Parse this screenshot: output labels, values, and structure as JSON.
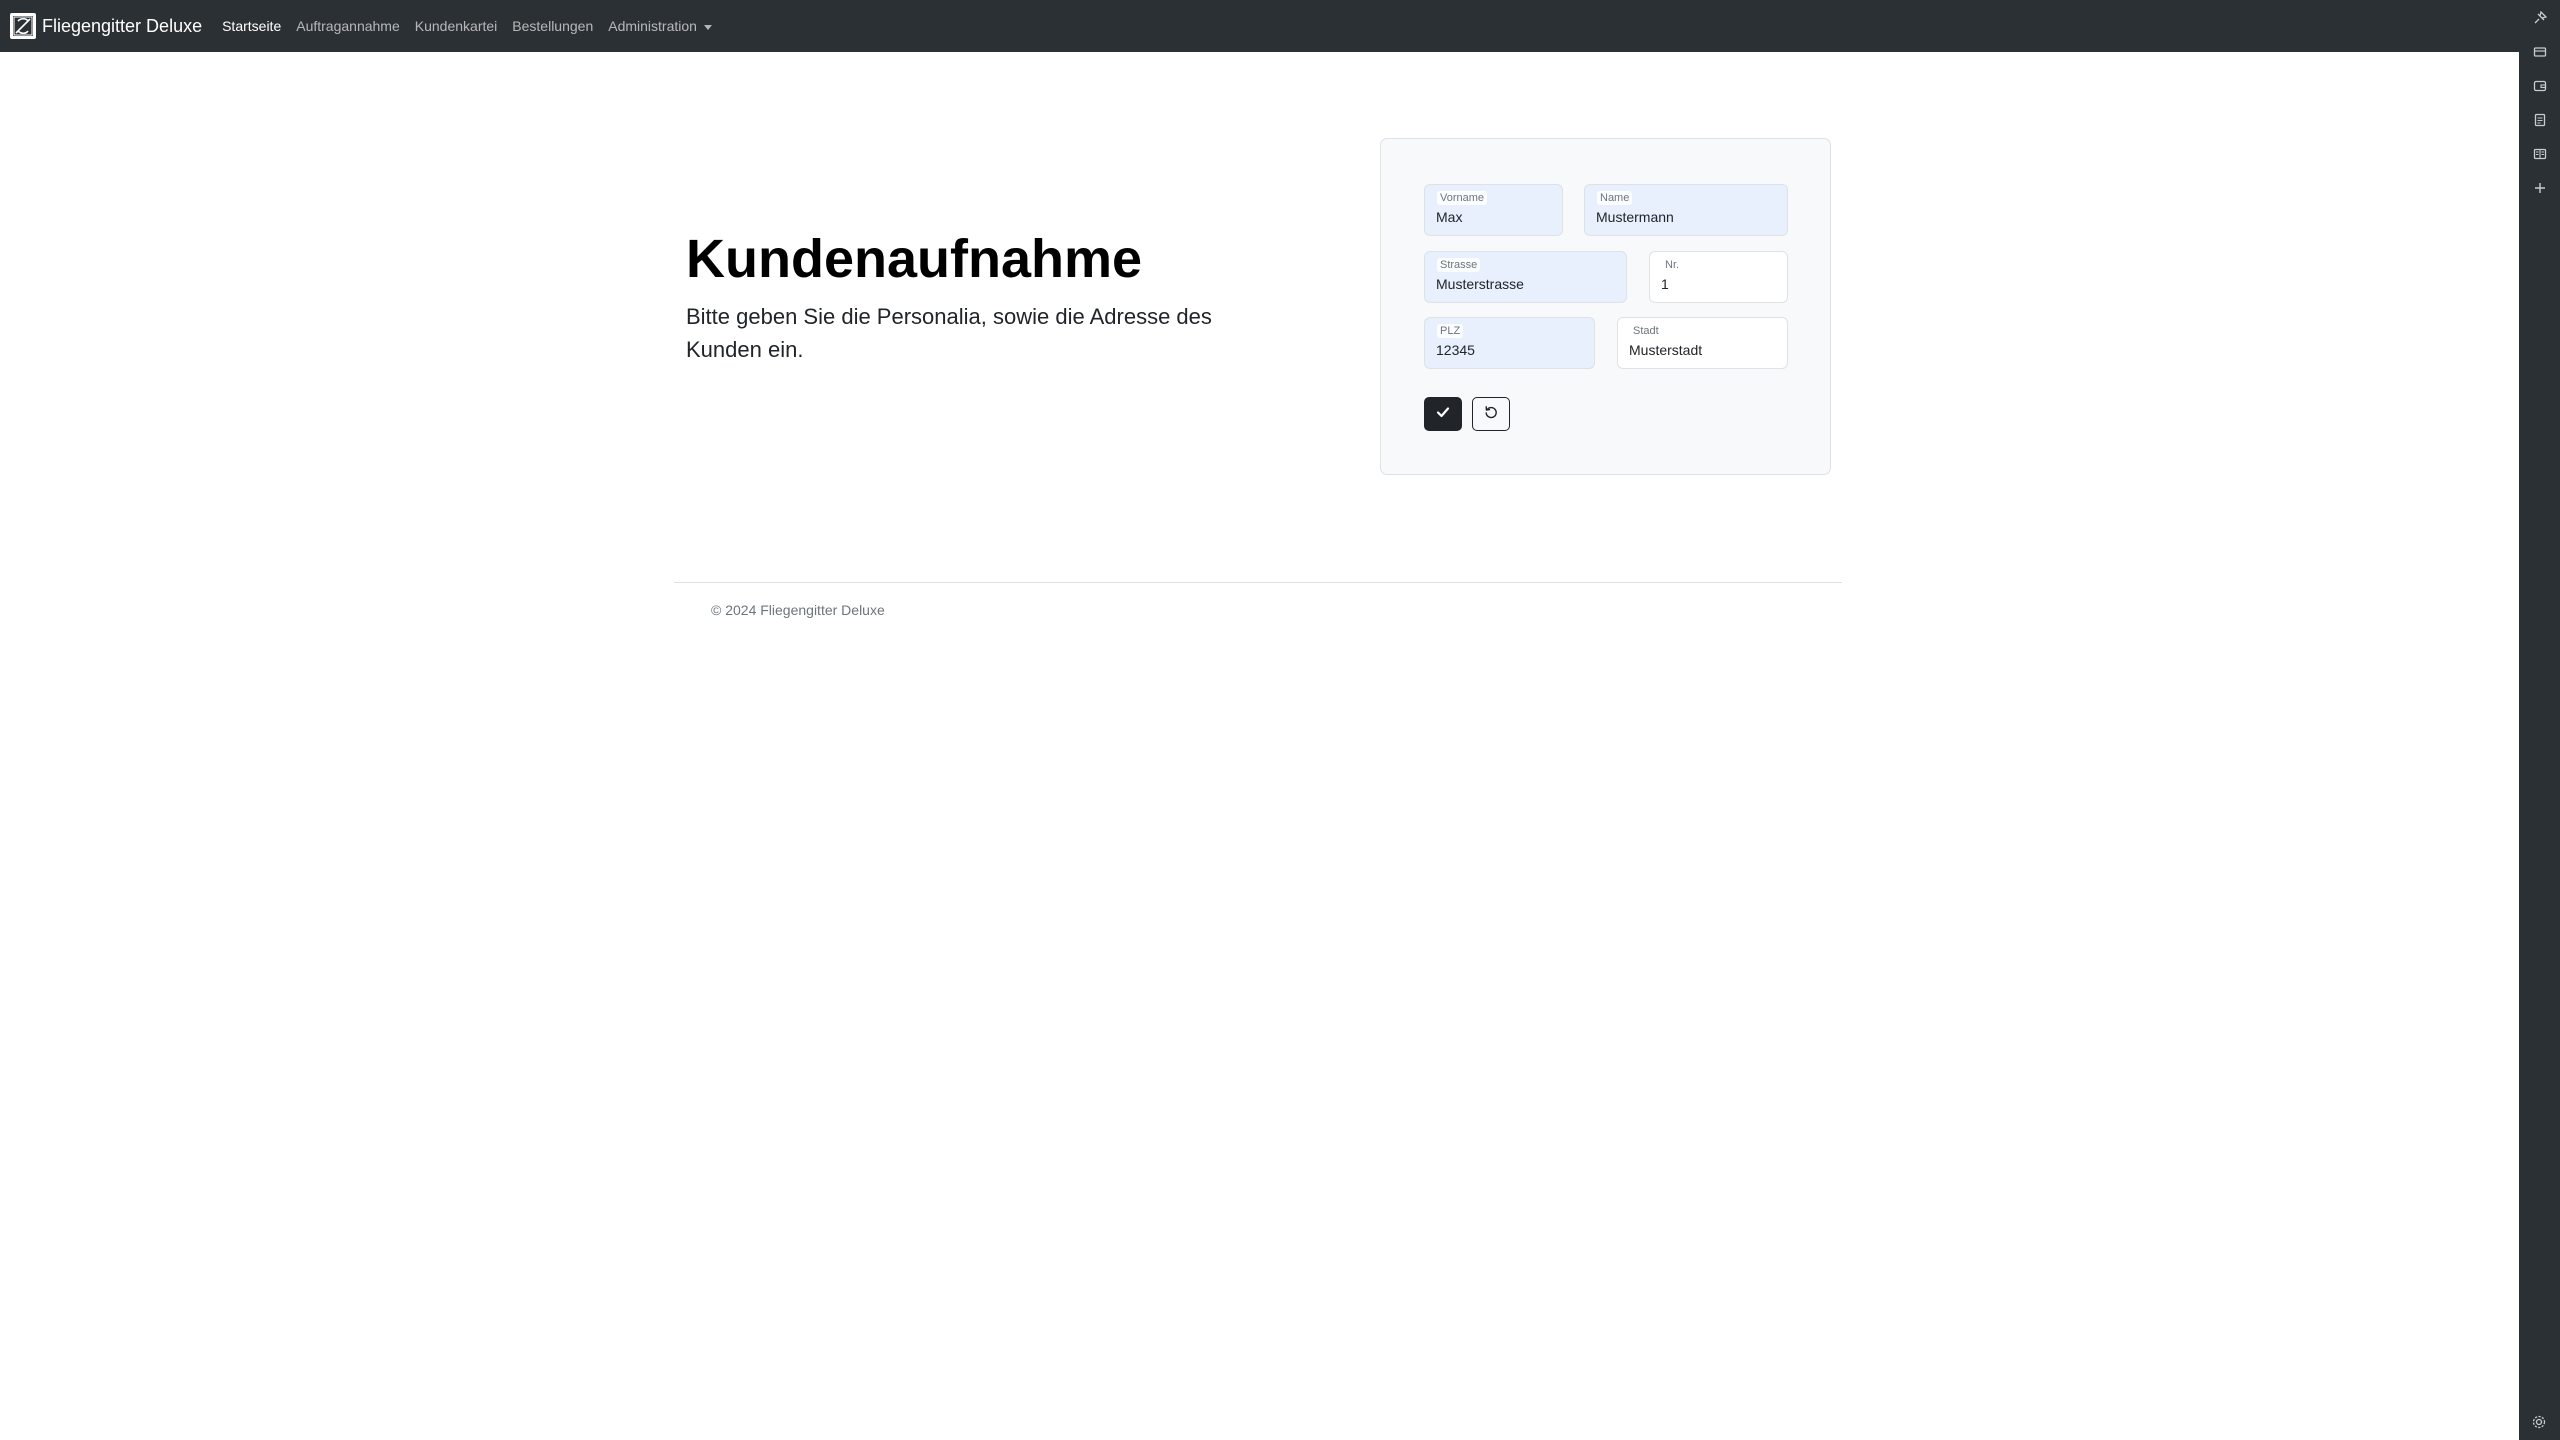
{
  "navbar": {
    "brand": "Fliegengitter Deluxe",
    "links": [
      {
        "label": "Startseite",
        "active": true
      },
      {
        "label": "Auftragannahme",
        "active": false
      },
      {
        "label": "Kundenkartei",
        "active": false
      },
      {
        "label": "Bestellungen",
        "active": false
      },
      {
        "label": "Administration",
        "active": false,
        "dropdown": true
      }
    ]
  },
  "hero": {
    "title": "Kundenaufnahme",
    "lead": "Bitte geben Sie die Personalia, sowie die Adresse des Kunden ein."
  },
  "form": {
    "vorname": {
      "label": "Vorname",
      "value": "Max"
    },
    "name": {
      "label": "Name",
      "value": "Mustermann"
    },
    "strasse": {
      "label": "Strasse",
      "value": "Musterstrasse"
    },
    "nr": {
      "label": "Nr.",
      "value": "1"
    },
    "plz": {
      "label": "PLZ",
      "value": "12345"
    },
    "stadt": {
      "label": "Stadt",
      "value": "Musterstadt"
    },
    "submit_icon": "check-icon",
    "reset_icon": "reset-arrow-icon"
  },
  "footer": {
    "text": "© 2024 Fliegengitter Deluxe"
  },
  "side_panel": {
    "icons": [
      "sparkle-pin-icon",
      "tab-icon",
      "wallet-icon",
      "document-icon",
      "reading-list-icon",
      "add-icon",
      "settings-icon"
    ]
  },
  "colors": {
    "navbar_bg": "#2b3035",
    "autofill_bg": "#e8f0fe",
    "card_bg": "#f8f9fa",
    "button_dark": "#212529"
  }
}
